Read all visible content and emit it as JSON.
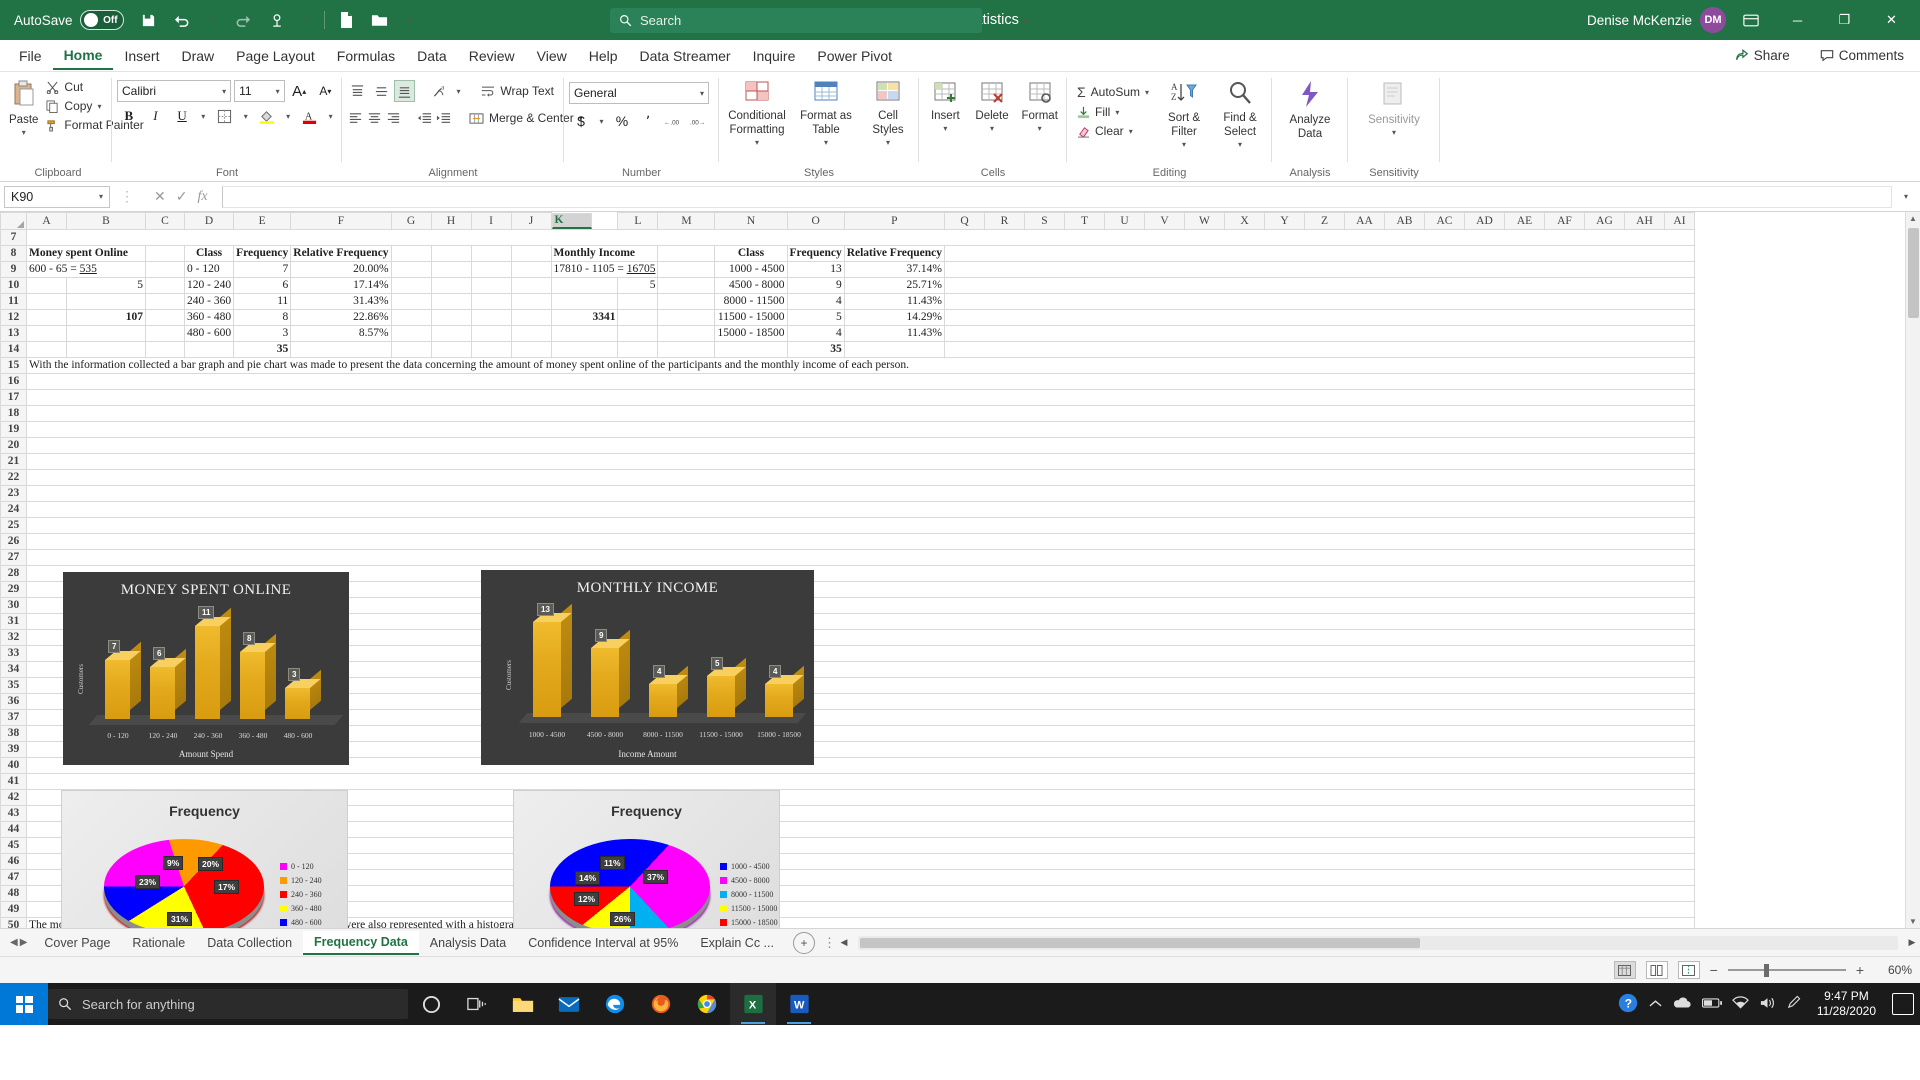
{
  "titlebar": {
    "autosave_label": "AutoSave",
    "autosave_state": "Off",
    "save_icon": "save-icon",
    "undo_icon": "undo-icon",
    "redo_icon": "redo-icon",
    "touch_icon": "touch-mode-icon",
    "new_icon": "new-file-icon",
    "open_icon": "open-folder-icon",
    "customize_icon": "customize-quick-access-icon",
    "document_title": "Inferential Statistics",
    "search_placeholder": "Search",
    "search_icon": "search-icon",
    "user_name": "Denise McKenzie",
    "user_initials": "DM",
    "ribbon_display_icon": "ribbon-display-options-icon",
    "minimize_label": "─",
    "maximize_label": "❐",
    "close_label": "✕"
  },
  "menubar": {
    "items": [
      {
        "label": "File"
      },
      {
        "label": "Home"
      },
      {
        "label": "Insert"
      },
      {
        "label": "Draw"
      },
      {
        "label": "Page Layout"
      },
      {
        "label": "Formulas"
      },
      {
        "label": "Data"
      },
      {
        "label": "Review"
      },
      {
        "label": "View"
      },
      {
        "label": "Help"
      },
      {
        "label": "Data Streamer"
      },
      {
        "label": "Inquire"
      },
      {
        "label": "Power Pivot"
      }
    ],
    "active_index": 1,
    "share_label": "Share",
    "comments_label": "Comments"
  },
  "ribbon": {
    "clipboard": {
      "group_label": "Clipboard",
      "paste_label": "Paste",
      "cut_label": "Cut",
      "copy_label": "Copy",
      "format_painter_label": "Format Painter"
    },
    "font": {
      "group_label": "Font",
      "font_name": "Calibri",
      "font_size": "11",
      "grow_label": "A",
      "shrink_label": "A",
      "bold_label": "B",
      "italic_label": "I",
      "underline_label": "U",
      "borders_icon": "borders-icon",
      "fill_color_icon": "fill-color-icon",
      "font_color_icon": "font-color-icon"
    },
    "alignment": {
      "group_label": "Alignment",
      "wrap_text_label": "Wrap Text",
      "merge_center_label": "Merge & Center",
      "orientation_icon": "orientation-icon",
      "decrease_indent_icon": "decrease-indent-icon",
      "increase_indent_icon": "increase-indent-icon"
    },
    "number": {
      "group_label": "Number",
      "format": "General",
      "currency_label": "$",
      "percent_label": "%",
      "comma_label": "٬",
      "increase_decimal_label": ".00",
      "decrease_decimal_label": ".00"
    },
    "styles": {
      "group_label": "Styles",
      "conditional_formatting_label": "Conditional Formatting",
      "format_as_table_label": "Format as Table",
      "cell_styles_label": "Cell Styles"
    },
    "cells": {
      "group_label": "Cells",
      "insert_label": "Insert",
      "delete_label": "Delete",
      "format_label": "Format"
    },
    "editing": {
      "group_label": "Editing",
      "autosum_label": "AutoSum",
      "fill_label": "Fill",
      "clear_label": "Clear",
      "sort_filter_label": "Sort & Filter",
      "find_select_label": "Find & Select"
    },
    "analysis": {
      "group_label": "Analysis",
      "analyze_data_label": "Analyze Data"
    },
    "sensitivity": {
      "group_label": "Sensitivity",
      "sensitivity_label": "Sensitivity"
    }
  },
  "formula_bar": {
    "name_box": "K90",
    "cancel_icon": "cancel-icon",
    "enter_icon": "enter-icon",
    "function_icon": "insert-function-icon",
    "formula_value": ""
  },
  "grid": {
    "columns": [
      "A",
      "B",
      "C",
      "D",
      "E",
      "F",
      "G",
      "H",
      "I",
      "J",
      "K",
      "L",
      "M",
      "N",
      "O",
      "P",
      "Q",
      "R",
      "S",
      "T",
      "U",
      "V",
      "W",
      "X",
      "Y",
      "Z",
      "AA",
      "AB",
      "AC",
      "AD",
      "AE",
      "AF",
      "AG",
      "AH",
      "AI"
    ],
    "selected_column": "K",
    "rows": [
      7,
      8,
      9,
      10,
      11,
      12,
      13,
      14,
      15,
      16,
      17,
      18,
      19,
      20,
      21,
      22,
      23,
      24,
      25,
      26,
      27,
      28,
      29,
      30,
      31,
      32,
      33,
      34,
      35,
      36,
      37,
      38,
      39,
      40,
      41,
      42,
      43,
      44,
      45,
      46,
      47,
      48,
      49,
      50
    ],
    "cells": {
      "A8": "Money spent Online",
      "A9_pre": "600 - 65 = ",
      "A9_val": "535",
      "B10": "5",
      "B12": "107",
      "D8": "Class",
      "E8": "Frequency",
      "F8": "Relative Frequency",
      "K8": "Monthly Income",
      "K9_pre": "17810 - 1105 = ",
      "K9_val": "16705",
      "L10": "5",
      "L12": "3341",
      "N8": "Class",
      "O8": "Frequency",
      "P8": "Relative Frequency",
      "E14_total": "35",
      "O14_total": "35",
      "A15_note": "With the information collected a bar graph and pie chart was made to present the data concerning the amount of money spent online of the participants and the monthly income of each person.",
      "A50_note": "The money spent online of the participants and the monthly income were also represented with a histogram, a frequency polygons and a ogive."
    },
    "money_table": {
      "classes": [
        "0 - 120",
        "120 - 240",
        "240 - 360",
        "360 - 480",
        "480 - 600"
      ],
      "frequencies": [
        "7",
        "6",
        "11",
        "8",
        "3"
      ],
      "relative": [
        "20.00%",
        "17.14%",
        "31.43%",
        "22.86%",
        "8.57%"
      ]
    },
    "income_table": {
      "classes": [
        "1000 - 4500",
        "4500 - 8000",
        "8000 - 11500",
        "11500 - 15000",
        "15000 - 18500"
      ],
      "frequencies": [
        "13",
        "9",
        "4",
        "5",
        "4"
      ],
      "relative": [
        "37.14%",
        "25.71%",
        "11.43%",
        "14.29%",
        "11.43%"
      ]
    }
  },
  "chart_data": [
    {
      "type": "bar",
      "name": "money-spent-bar-chart",
      "title": "MONEY SPENT ONLINE",
      "xlabel": "Amount Spend",
      "ylabel": "Customers",
      "categories": [
        "0 - 120",
        "120 - 240",
        "240 - 360",
        "360 - 480",
        "480 - 600"
      ],
      "values": [
        7,
        6,
        11,
        8,
        3
      ],
      "ylim": [
        0,
        12
      ],
      "grid": false,
      "legend": "none",
      "bar_color": "#e3a81c",
      "background": "#3b3b3b"
    },
    {
      "type": "bar",
      "name": "monthly-income-bar-chart",
      "title": "MONTHLY INCOME",
      "xlabel": "Income Amount",
      "ylabel": "Customers",
      "categories": [
        "1000 - 4500",
        "4500 - 8000",
        "8000 - 11500",
        "11500 - 15000",
        "15000 - 18500"
      ],
      "values": [
        13,
        9,
        4,
        5,
        4
      ],
      "ylim": [
        0,
        14
      ],
      "grid": false,
      "legend": "none",
      "bar_color": "#e3a81c",
      "background": "#3b3b3b"
    },
    {
      "type": "pie",
      "name": "money-spent-pie-chart",
      "title": "Frequency",
      "labels": [
        "0 - 120",
        "120 - 240",
        "240 - 360",
        "360 - 480",
        "480 - 600"
      ],
      "values": [
        20,
        17,
        31,
        23,
        9
      ],
      "display_labels": [
        "20%",
        "17%",
        "31%",
        "23%",
        "9%"
      ],
      "colors": [
        "#ff00ff",
        "#ff9900",
        "#ff0000",
        "#ffff00",
        "#0000ff"
      ],
      "legend": "right"
    },
    {
      "type": "pie",
      "name": "monthly-income-pie-chart",
      "title": "Frequency",
      "labels": [
        "1000 - 4500",
        "4500 - 8000",
        "8000 - 11500",
        "11500 - 15000",
        "15000 - 18500"
      ],
      "values": [
        37,
        26,
        12,
        14,
        11
      ],
      "display_labels": [
        "37%",
        "26%",
        "12%",
        "14%",
        "11%"
      ],
      "colors": [
        "#0000ff",
        "#ff00ff",
        "#00b0f0",
        "#ffff00",
        "#ff0000"
      ],
      "legend": "right"
    }
  ],
  "sheet_tabs": {
    "items": [
      {
        "label": "Cover Page"
      },
      {
        "label": "Rationale"
      },
      {
        "label": "Data Collection"
      },
      {
        "label": "Frequency Data"
      },
      {
        "label": "Analysis Data"
      },
      {
        "label": "Confidence Interval at 95%"
      },
      {
        "label": "Explain Cc ..."
      }
    ],
    "active_index": 3,
    "add_sheet_label": "+"
  },
  "statusbar": {
    "ready_text": "",
    "normal_view_icon": "normal-view-icon",
    "page_layout_icon": "page-layout-view-icon",
    "page_break_icon": "page-break-view-icon",
    "zoom_out_label": "−",
    "zoom_in_label": "+",
    "zoom_level": "60%"
  },
  "taskbar": {
    "start_icon": "windows-start-icon",
    "search_placeholder": "Search for anything",
    "search_icon": "search-icon",
    "cortana_icon": "cortana-icon",
    "taskview_icon": "task-view-icon",
    "apps": [
      {
        "name": "file-explorer-icon"
      },
      {
        "name": "mail-icon"
      },
      {
        "name": "edge-icon"
      },
      {
        "name": "firefox-icon"
      },
      {
        "name": "chrome-icon"
      },
      {
        "name": "excel-icon"
      },
      {
        "name": "word-icon"
      }
    ],
    "tray": [
      {
        "name": "help-icon"
      },
      {
        "name": "show-hidden-icons-icon"
      },
      {
        "name": "onedrive-icon"
      },
      {
        "name": "battery-icon"
      },
      {
        "name": "network-icon"
      },
      {
        "name": "volume-icon"
      },
      {
        "name": "pen-icon"
      }
    ],
    "time": "9:47 PM",
    "date": "11/28/2020",
    "notification_icon": "notification-center-icon"
  }
}
